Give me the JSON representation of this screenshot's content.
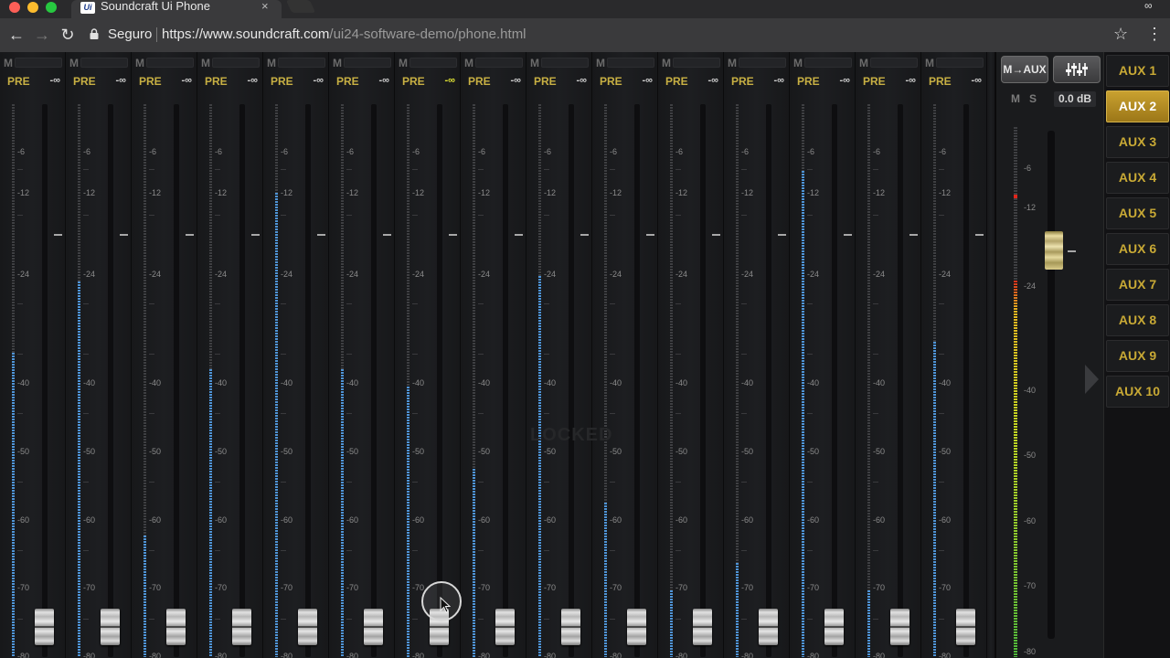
{
  "window": {
    "tab_title": "Soundcraft Ui Phone",
    "tab_close": "×",
    "tab_logo": "Ui",
    "traffic_lights": [
      "#fc5f57",
      "#fdbc2e",
      "#27c840"
    ]
  },
  "toolbar": {
    "back": "←",
    "forward": "→",
    "reload": "↻",
    "secure_label": "Seguro",
    "url_host": "https://www.soundcraft.com",
    "url_path": "/ui24-software-demo/phone.html",
    "star": "☆",
    "menu": "⋮",
    "profile": "∞"
  },
  "mixer": {
    "mute_label": "M",
    "pre_label": "PRE",
    "scale": [
      "-6",
      "-12",
      "-24",
      "-40",
      "-50",
      "-60",
      "-70",
      "-80"
    ],
    "channels": [
      {
        "level": "-∞",
        "meter": 0.55,
        "active": false
      },
      {
        "level": "-∞",
        "meter": 0.68,
        "active": false
      },
      {
        "level": "-∞",
        "meter": 0.22,
        "active": false
      },
      {
        "level": "-∞",
        "meter": 0.52,
        "active": false
      },
      {
        "level": "-∞",
        "meter": 0.84,
        "active": false
      },
      {
        "level": "-∞",
        "meter": 0.52,
        "active": false
      },
      {
        "level": "-∞",
        "meter": 0.49,
        "active": true
      },
      {
        "level": "-∞",
        "meter": 0.34,
        "active": false
      },
      {
        "level": "-∞",
        "meter": 0.69,
        "active": false
      },
      {
        "level": "-∞",
        "meter": 0.28,
        "active": false
      },
      {
        "level": "-∞",
        "meter": 0.12,
        "active": false
      },
      {
        "level": "-∞",
        "meter": 0.17,
        "active": false
      },
      {
        "level": "-∞",
        "meter": 0.88,
        "active": false
      },
      {
        "level": "-∞",
        "meter": 0.12,
        "active": false
      },
      {
        "level": "-∞",
        "meter": 0.57,
        "active": false
      }
    ],
    "locked_watermark": "LOCKED"
  },
  "master": {
    "m_aux_button": "M→AUX",
    "faders_icon": "faders-icon",
    "mute": "M",
    "solo": "S",
    "gain": "0.0 dB",
    "scale": [
      "-6",
      "-12",
      "-24",
      "-40",
      "-50",
      "-60",
      "-70",
      "-80"
    ],
    "meter_level": 0.71
  },
  "aux": {
    "items": [
      "AUX 1",
      "AUX 2",
      "AUX 3",
      "AUX 4",
      "AUX 5",
      "AUX 6",
      "AUX 7",
      "AUX 8",
      "AUX 9",
      "AUX 10"
    ],
    "selected_index": 1,
    "accent": "#c8a935"
  }
}
